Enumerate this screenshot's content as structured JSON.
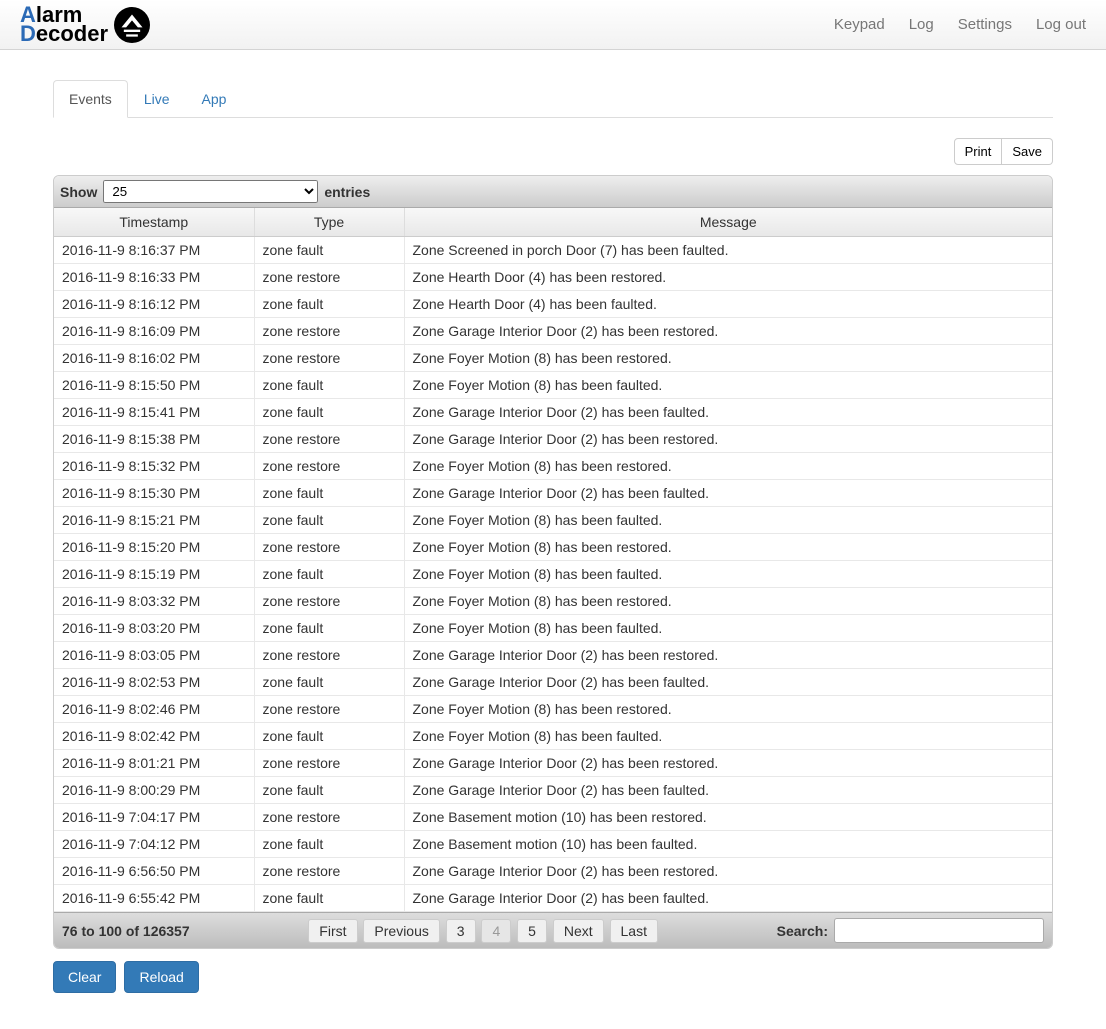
{
  "brand": {
    "part1a": "A",
    "part1b": "larm",
    "part2a": "D",
    "part2b": "ecoder"
  },
  "nav": {
    "keypad": "Keypad",
    "log": "Log",
    "settings": "Settings",
    "logout": "Log out"
  },
  "tabs": {
    "events": "Events",
    "live": "Live",
    "app": "App"
  },
  "toolbar": {
    "print": "Print",
    "save": "Save"
  },
  "length": {
    "show": "Show",
    "value": "25",
    "entries": "entries"
  },
  "columns": {
    "ts": "Timestamp",
    "type": "Type",
    "msg": "Message"
  },
  "rows": [
    {
      "ts": "2016-11-9 8:16:37 PM",
      "type": "zone fault",
      "msg": "Zone Screened in porch Door (7) has been faulted."
    },
    {
      "ts": "2016-11-9 8:16:33 PM",
      "type": "zone restore",
      "msg": "Zone Hearth Door (4) has been restored."
    },
    {
      "ts": "2016-11-9 8:16:12 PM",
      "type": "zone fault",
      "msg": "Zone Hearth Door (4) has been faulted."
    },
    {
      "ts": "2016-11-9 8:16:09 PM",
      "type": "zone restore",
      "msg": "Zone Garage Interior Door (2) has been restored."
    },
    {
      "ts": "2016-11-9 8:16:02 PM",
      "type": "zone restore",
      "msg": "Zone Foyer Motion (8) has been restored."
    },
    {
      "ts": "2016-11-9 8:15:50 PM",
      "type": "zone fault",
      "msg": "Zone Foyer Motion (8) has been faulted."
    },
    {
      "ts": "2016-11-9 8:15:41 PM",
      "type": "zone fault",
      "msg": "Zone Garage Interior Door (2) has been faulted."
    },
    {
      "ts": "2016-11-9 8:15:38 PM",
      "type": "zone restore",
      "msg": "Zone Garage Interior Door (2) has been restored."
    },
    {
      "ts": "2016-11-9 8:15:32 PM",
      "type": "zone restore",
      "msg": "Zone Foyer Motion (8) has been restored."
    },
    {
      "ts": "2016-11-9 8:15:30 PM",
      "type": "zone fault",
      "msg": "Zone Garage Interior Door (2) has been faulted."
    },
    {
      "ts": "2016-11-9 8:15:21 PM",
      "type": "zone fault",
      "msg": "Zone Foyer Motion (8) has been faulted."
    },
    {
      "ts": "2016-11-9 8:15:20 PM",
      "type": "zone restore",
      "msg": "Zone Foyer Motion (8) has been restored."
    },
    {
      "ts": "2016-11-9 8:15:19 PM",
      "type": "zone fault",
      "msg": "Zone Foyer Motion (8) has been faulted."
    },
    {
      "ts": "2016-11-9 8:03:32 PM",
      "type": "zone restore",
      "msg": "Zone Foyer Motion (8) has been restored."
    },
    {
      "ts": "2016-11-9 8:03:20 PM",
      "type": "zone fault",
      "msg": "Zone Foyer Motion (8) has been faulted."
    },
    {
      "ts": "2016-11-9 8:03:05 PM",
      "type": "zone restore",
      "msg": "Zone Garage Interior Door (2) has been restored."
    },
    {
      "ts": "2016-11-9 8:02:53 PM",
      "type": "zone fault",
      "msg": "Zone Garage Interior Door (2) has been faulted."
    },
    {
      "ts": "2016-11-9 8:02:46 PM",
      "type": "zone restore",
      "msg": "Zone Foyer Motion (8) has been restored."
    },
    {
      "ts": "2016-11-9 8:02:42 PM",
      "type": "zone fault",
      "msg": "Zone Foyer Motion (8) has been faulted."
    },
    {
      "ts": "2016-11-9 8:01:21 PM",
      "type": "zone restore",
      "msg": "Zone Garage Interior Door (2) has been restored."
    },
    {
      "ts": "2016-11-9 8:00:29 PM",
      "type": "zone fault",
      "msg": "Zone Garage Interior Door (2) has been faulted."
    },
    {
      "ts": "2016-11-9 7:04:17 PM",
      "type": "zone restore",
      "msg": "Zone Basement motion (10) has been restored."
    },
    {
      "ts": "2016-11-9 7:04:12 PM",
      "type": "zone fault",
      "msg": "Zone Basement motion (10) has been faulted."
    },
    {
      "ts": "2016-11-9 6:56:50 PM",
      "type": "zone restore",
      "msg": "Zone Garage Interior Door (2) has been restored."
    },
    {
      "ts": "2016-11-9 6:55:42 PM",
      "type": "zone fault",
      "msg": "Zone Garage Interior Door (2) has been faulted."
    }
  ],
  "footer": {
    "info": "76 to 100 of 126357",
    "pager": {
      "first": "First",
      "prev": "Previous",
      "p3": "3",
      "p4": "4",
      "p5": "5",
      "next": "Next",
      "last": "Last"
    },
    "search_label": "Search:",
    "search_value": ""
  },
  "actions": {
    "clear": "Clear",
    "reload": "Reload"
  }
}
